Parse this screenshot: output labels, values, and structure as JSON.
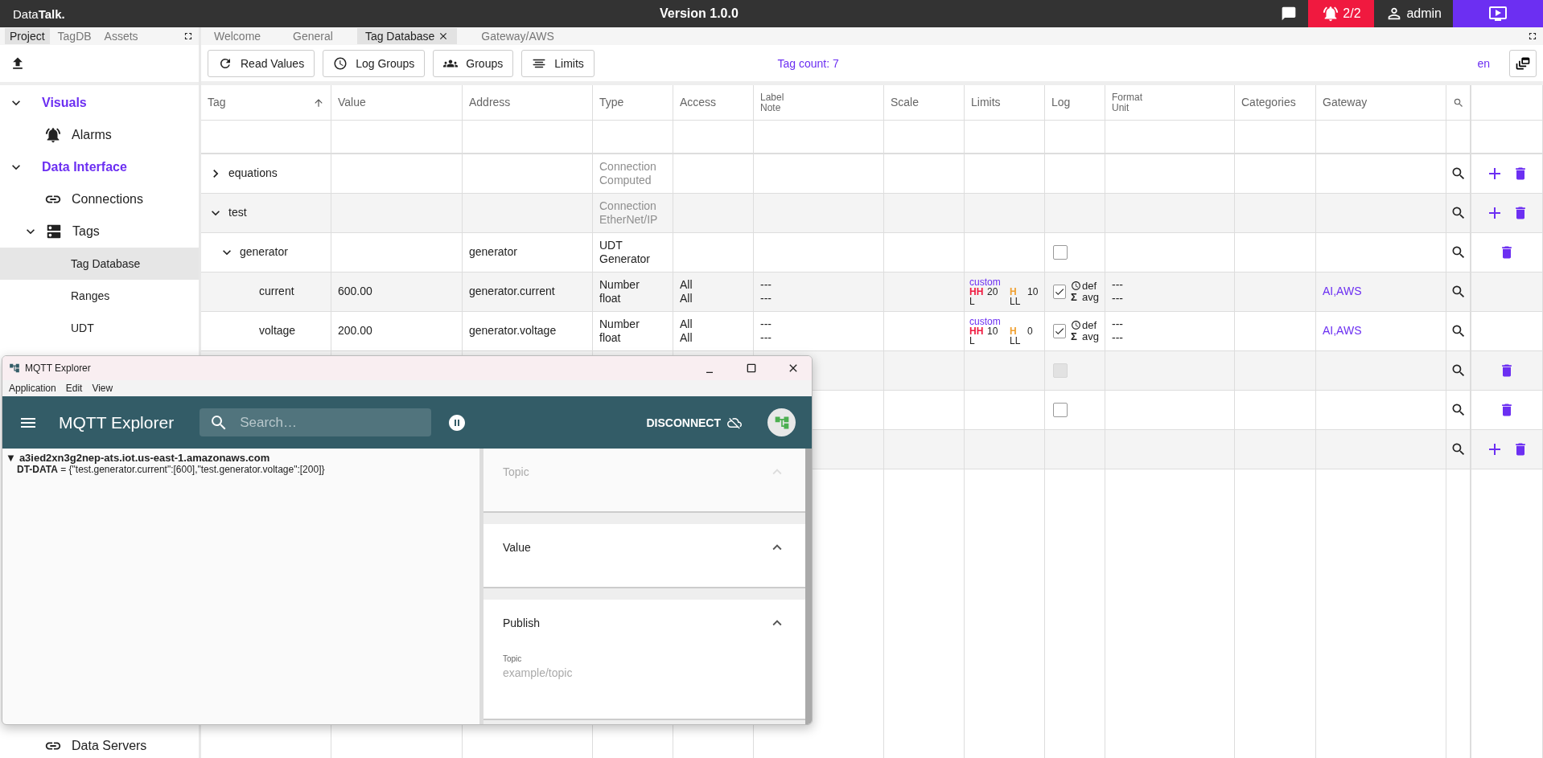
{
  "topbar": {
    "logo": "Data**Talk.**",
    "version": "Version 1.0.0",
    "alarm_count": "2/2",
    "user": "admin"
  },
  "sidebar": {
    "tabs": [
      {
        "label": "Project",
        "selected": true
      },
      {
        "label": "TagDB",
        "selected": false
      },
      {
        "label": "Assets",
        "selected": false
      }
    ],
    "nav": [
      {
        "label": "Visuals",
        "expanded": true,
        "selected": false,
        "children": [
          {
            "label": "Alarms",
            "kind": "alarm",
            "selected": false
          }
        ]
      },
      {
        "label": "Data Interface",
        "expanded": true,
        "selected": false,
        "children": [
          {
            "label": "Connections",
            "kind": "link",
            "selected": false
          },
          {
            "label": "Tags",
            "kind": "server",
            "expanded": true,
            "selected": false,
            "children": [
              {
                "label": "Tag Database",
                "selected": true
              },
              {
                "label": "Ranges",
                "selected": false
              },
              {
                "label": "UDT",
                "selected": false
              }
            ]
          }
        ]
      }
    ],
    "nav_bottom": [
      {
        "label": "Data Servers",
        "kind": "link",
        "selected": false
      }
    ]
  },
  "main_tabs": [
    {
      "label": "Welcome",
      "selected": false,
      "closable": false
    },
    {
      "label": "General",
      "selected": false,
      "closable": false
    },
    {
      "label": "Tag Database",
      "selected": true,
      "closable": true
    },
    {
      "label": "Gateway/AWS",
      "selected": false,
      "closable": false
    }
  ],
  "toolbar": {
    "buttons": [
      {
        "label": "Read Values",
        "kind": "refresh"
      },
      {
        "label": "Log Groups",
        "kind": "clock"
      },
      {
        "label": "Groups",
        "kind": "groups"
      },
      {
        "label": "Limits",
        "kind": "limits"
      }
    ],
    "tag_count": "Tag count: 7",
    "language": "en"
  },
  "table": {
    "columns": [
      {
        "label": "Tag",
        "sorted": true
      },
      {
        "label": "Value"
      },
      {
        "label": "Address"
      },
      {
        "label": "Type"
      },
      {
        "label": "Access"
      },
      {
        "label": "Label\nNote"
      },
      {
        "label": "Scale"
      },
      {
        "label": "Limits"
      },
      {
        "label": "Log"
      },
      {
        "label": "Format\nUnit"
      },
      {
        "label": "Categories"
      },
      {
        "label": "Gateway"
      }
    ],
    "rows": [
      {
        "name": "equations",
        "type_disabled": true,
        "expanded": false,
        "type": "Connection\nComputed",
        "can_add": true,
        "can_delete": true
      },
      {
        "name": "test",
        "type_disabled": true,
        "expanded": true,
        "type": "Connection\nEtherNet/IP",
        "can_add": true,
        "can_delete": true,
        "children": [
          {
            "name": "generator",
            "type_disabled": false,
            "expanded": true,
            "address": "generator",
            "type": "UDT\nGenerator",
            "log": {
              "checked": false,
              "disabled": false
            },
            "can_delete": true,
            "children": [
              {
                "name": "current",
                "type_disabled": false,
                "value": "600.00",
                "address": "generator.current",
                "type": "Number\nfloat",
                "access": "All\nAll",
                "label_note": "---\n---",
                "limits": {
                  "preset": "custom",
                  "items": [
                    {
                      "label": "HH",
                      "value": "20",
                      "kind": "hh"
                    },
                    {
                      "label": "H",
                      "value": "10",
                      "kind": "h"
                    },
                    {
                      "label": "L",
                      "value": "",
                      "kind": "l"
                    },
                    {
                      "label": "LL",
                      "value": "",
                      "kind": "ll"
                    }
                  ]
                },
                "log": {
                  "checked": true,
                  "disabled": false,
                  "mode": "def",
                  "aggregate_symbol": "Σ",
                  "aggregate": "avg"
                },
                "format_unit": "---\n---",
                "gateway": "AI,AWS"
              },
              {
                "name": "voltage",
                "type_disabled": false,
                "value": "200.00",
                "address": "generator.voltage",
                "type": "Number\nfloat",
                "access": "All\nAll",
                "label_note": "---\n---",
                "limits": {
                  "preset": "custom",
                  "items": [
                    {
                      "label": "HH",
                      "value": "10",
                      "kind": "hh"
                    },
                    {
                      "label": "H",
                      "value": "0",
                      "kind": "h"
                    },
                    {
                      "label": "L",
                      "value": "",
                      "kind": "l"
                    },
                    {
                      "label": "LL",
                      "value": "",
                      "kind": "ll"
                    }
                  ]
                },
                "log": {
                  "checked": true,
                  "disabled": false,
                  "mode": "def",
                  "aggregate_symbol": "Σ",
                  "aggregate": "avg"
                },
                "format_unit": "---\n---",
                "gateway": "AI,AWS"
              }
            ]
          }
        ]
      },
      {
        "log": {
          "checked": false,
          "disabled": true
        },
        "can_delete": true
      },
      {
        "log": {
          "checked": false,
          "disabled": false
        },
        "can_delete": true
      },
      {
        "can_add": true,
        "can_delete": true
      }
    ]
  },
  "mqtt": {
    "title": "MQTT Explorer",
    "menu": [
      "Application",
      "Edit",
      "View"
    ],
    "app_title": "MQTT Explorer",
    "search_placeholder": "Search…",
    "disconnect": "DISCONNECT",
    "tree": [
      {
        "toggle": "▼",
        "host": "a3ied2xn3g2nep-ats.iot.us-east-1.amazonaws.com",
        "children": [
          {
            "line": "**DT-DATA** = {\"test.generator.current\":[600],\"test.generator.voltage\":[200]}"
          }
        ]
      }
    ],
    "panels": [
      {
        "title": "Topic",
        "disabled": true
      },
      {
        "title": "Value",
        "disabled": false
      },
      {
        "title": "Publish",
        "disabled": false,
        "field_label": "Topic",
        "field_placeholder": "example/topic"
      }
    ]
  }
}
